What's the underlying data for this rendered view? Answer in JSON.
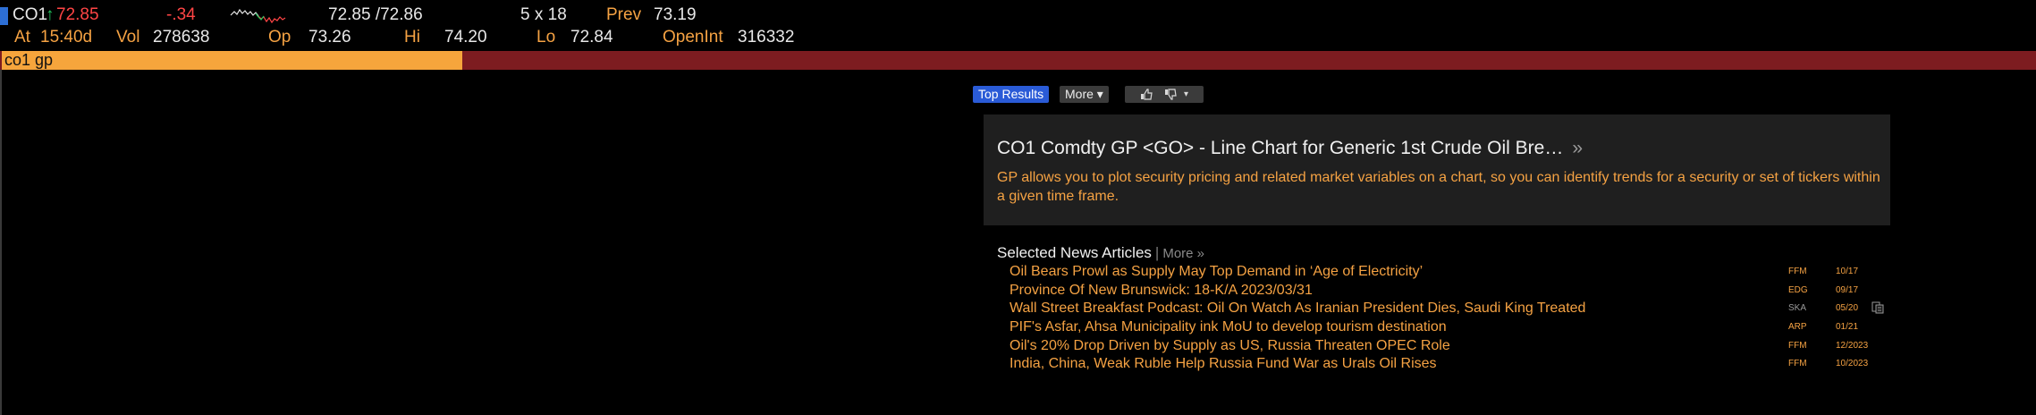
{
  "quote": {
    "ticker": "CO1",
    "arrow": "↑",
    "last": "72.85",
    "change": "-.34",
    "bid_ask": "72.85 /72.86",
    "size": "5 x 18",
    "prev_label": "Prev",
    "prev_value": "73.19",
    "at_label": "At",
    "time": "15:40d",
    "vol_label": "Vol",
    "vol_value": "278638",
    "op_label": "Op",
    "op_value": "73.26",
    "hi_label": "Hi",
    "hi_value": "74.20",
    "lo_label": "Lo",
    "lo_value": "72.84",
    "oi_label": "OpenInt",
    "oi_value": "316332",
    "sparkline_icon": "intraday-sparkline"
  },
  "command": {
    "value": "co1 gp"
  },
  "toolbar": {
    "top_results": "Top Results",
    "more": "More ▾",
    "thumbs_up_icon": "thumbs-up-icon",
    "thumbs_down_icon": "thumbs-down-icon"
  },
  "result": {
    "title": "CO1 Comdty GP <GO> - Line Chart for Generic 1st Crude Oil Bre…",
    "arrow": "»",
    "description": "GP  allows you to plot security pricing and related market variables on a chart, so you can identify trends for a security or set of tickers within a given time frame."
  },
  "news": {
    "heading": "Selected News Articles",
    "more": "More »",
    "items": [
      {
        "headline": "Oil Bears Prowl as Supply May Top Demand in ‘Age of Electricity’",
        "source": "FFM",
        "date": "10/17"
      },
      {
        "headline": "Province Of New Brunswick: 18-K/A 2023/03/31",
        "source": "EDG",
        "date": "09/17"
      },
      {
        "headline": "Wall Street Breakfast Podcast: Oil On Watch As Iranian President Dies, Saudi King Treated",
        "source": "SKA",
        "date": "05/20"
      },
      {
        "headline": "PIF's Asfar, Ahsa Municipality ink MoU to develop tourism destination",
        "source": "ARP",
        "date": "01/21"
      },
      {
        "headline": "Oil's 20% Drop Driven by Supply as US, Russia Threaten OPEC Role",
        "source": "FFM",
        "date": "12/2023"
      },
      {
        "headline": "India, China, Weak Ruble Help Russia Fund War as Urals Oil Rises",
        "source": "FFM",
        "date": "10/2023"
      }
    ]
  },
  "colors": {
    "amber": "#f5a243",
    "command_bar": "#7d1c20",
    "command_input": "#f6a53c",
    "price_down": "#ff4545",
    "arrow_up": "#22c55e",
    "button_blue": "#2a5bd7"
  }
}
